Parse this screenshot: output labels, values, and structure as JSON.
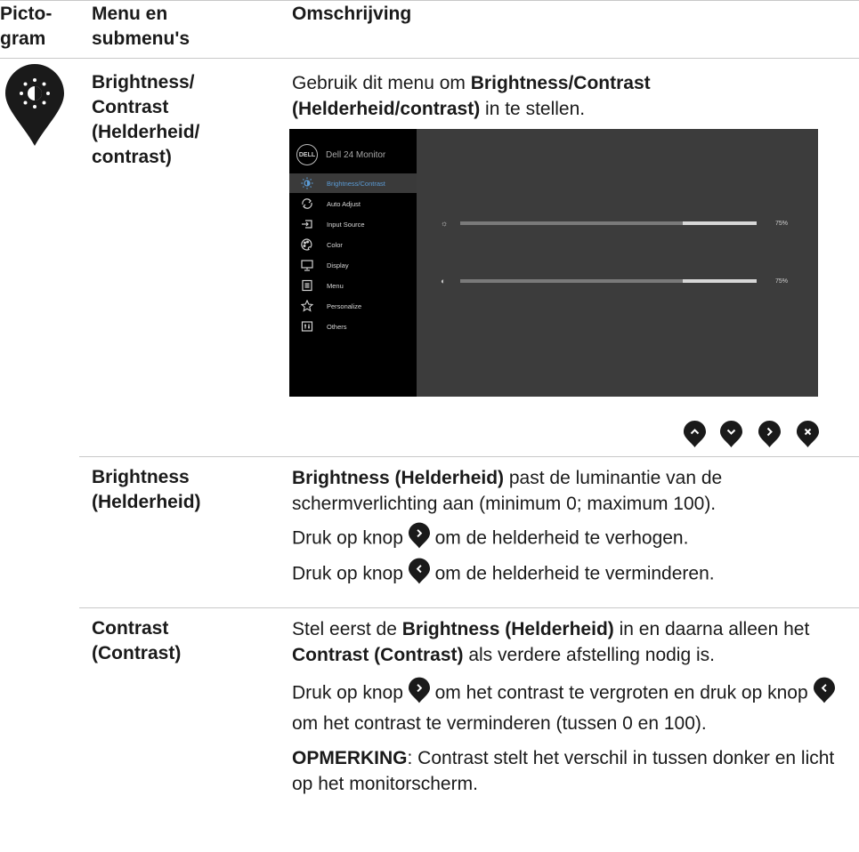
{
  "header": {
    "col1_line1": "Picto-",
    "col1_line2": "gram",
    "col2_line1": "Menu en",
    "col2_line2": "submenu's",
    "col3": "Omschrijving"
  },
  "row1": {
    "menu_lines": [
      "Brightness/",
      "Contrast",
      "(Helderheid/",
      "contrast)"
    ],
    "desc_pre": "Gebruik dit menu om ",
    "desc_bold": "Brightness/Contrast (Helderheid/contrast)",
    "desc_post": " in te stellen."
  },
  "osd": {
    "brand": "DELL",
    "title": "Dell 24 Monitor",
    "menu_items": [
      {
        "label": "Brightness/Contrast",
        "icon": "sun-icon",
        "selected": true
      },
      {
        "label": "Auto Adjust",
        "icon": "auto-adjust-icon",
        "selected": false
      },
      {
        "label": "Input Source",
        "icon": "input-source-icon",
        "selected": false
      },
      {
        "label": "Color",
        "icon": "palette-icon",
        "selected": false
      },
      {
        "label": "Display",
        "icon": "display-icon",
        "selected": false
      },
      {
        "label": "Menu",
        "icon": "menu-icon",
        "selected": false
      },
      {
        "label": "Personalize",
        "icon": "star-icon",
        "selected": false
      },
      {
        "label": "Others",
        "icon": "others-icon",
        "selected": false
      }
    ],
    "brightness_value": "75%",
    "contrast_value": "75%",
    "brightness_level": 0.75,
    "contrast_level": 0.75,
    "colors": {
      "bg": "#3c3c3c",
      "sidebar": "#000000",
      "selected_text": "#5b9bd5"
    }
  },
  "nav_buttons": [
    "up-button-icon",
    "down-button-icon",
    "right-button-icon",
    "close-button-icon"
  ],
  "row2": {
    "menu_lines": [
      "Brightness",
      "(Helderheid)"
    ],
    "p1_bold": "Brightness (Helderheid)",
    "p1_rest": " past de luminantie van de schermverlichting aan (minimum 0; maximum 100).",
    "p2_pre": "Druk op knop ",
    "p2_post": " om de helderheid te verhogen.",
    "p3_pre": "Druk op knop ",
    "p3_post": " om de helderheid te verminderen."
  },
  "row3": {
    "menu_lines": [
      "Contrast",
      "(Contrast)"
    ],
    "p1_a": "Stel eerst de ",
    "p1_b": "Brightness (Helderheid)",
    "p1_c": " in en daarna alleen het ",
    "p1_d": "Contrast (Contrast)",
    "p1_e": " als verdere afstelling nodig is.",
    "p2_a": "Druk op knop ",
    "p2_b": " om het contrast te vergroten en druk op knop ",
    "p2_c": " om het contrast te verminderen (tussen 0 en 100).",
    "note_label": "OPMERKING",
    "note_text": ": Contrast stelt het verschil in tussen donker en licht op het monitorscherm."
  }
}
